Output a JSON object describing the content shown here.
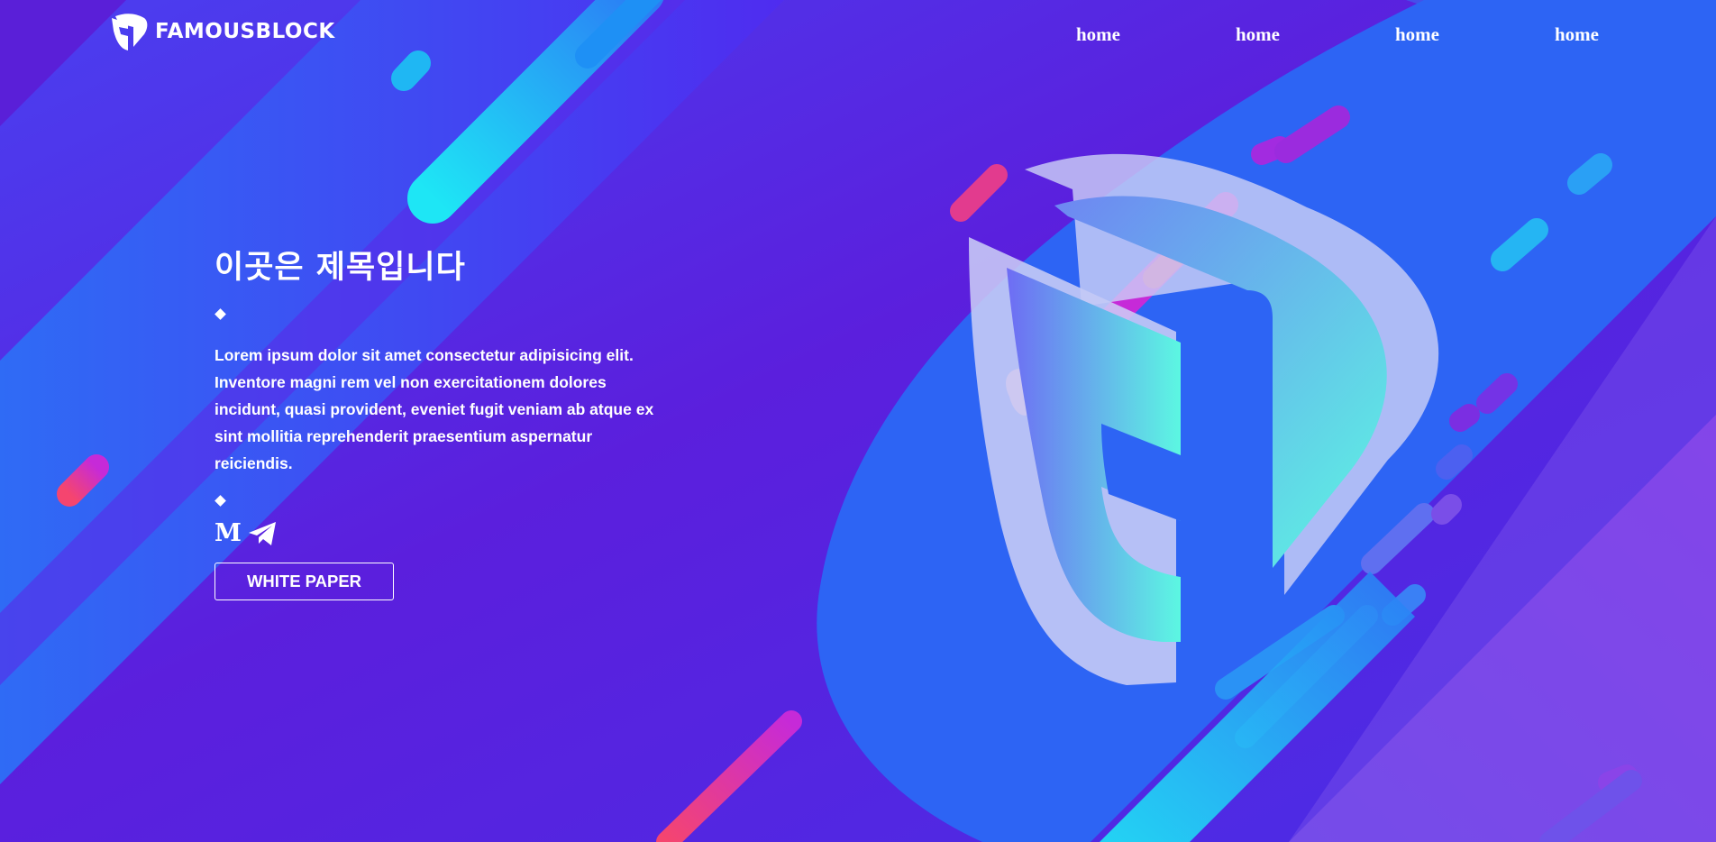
{
  "brand": {
    "logo_letter": "F",
    "name": "FAMOUSBLOCK"
  },
  "nav": {
    "items": [
      {
        "label": "home"
      },
      {
        "label": "home"
      },
      {
        "label": "home"
      },
      {
        "label": "home"
      }
    ]
  },
  "hero": {
    "title": "이곳은 제목입니다",
    "description": "Lorem ipsum dolor sit amet consectetur adipisicing elit. Inventore magni rem vel non exercitationem dolores incidunt, quasi provident, eveniet fugit veniam ab atque ex sint mollitia reprehenderit praesentium aspernatur reiciendis.",
    "social": {
      "medium_glyph": "M",
      "medium_icon": "medium-icon",
      "telegram_icon": "telegram-icon"
    },
    "button_label": "WHITE PAPER"
  },
  "colors": {
    "bg_blue": "#3f51f0",
    "bg_purple": "#5b18d8",
    "accent_cyan": "#1ee6f5",
    "accent_pink": "#f23d7a",
    "accent_violet": "#8d3ee3",
    "logo_teal": "#5ff5e0"
  }
}
